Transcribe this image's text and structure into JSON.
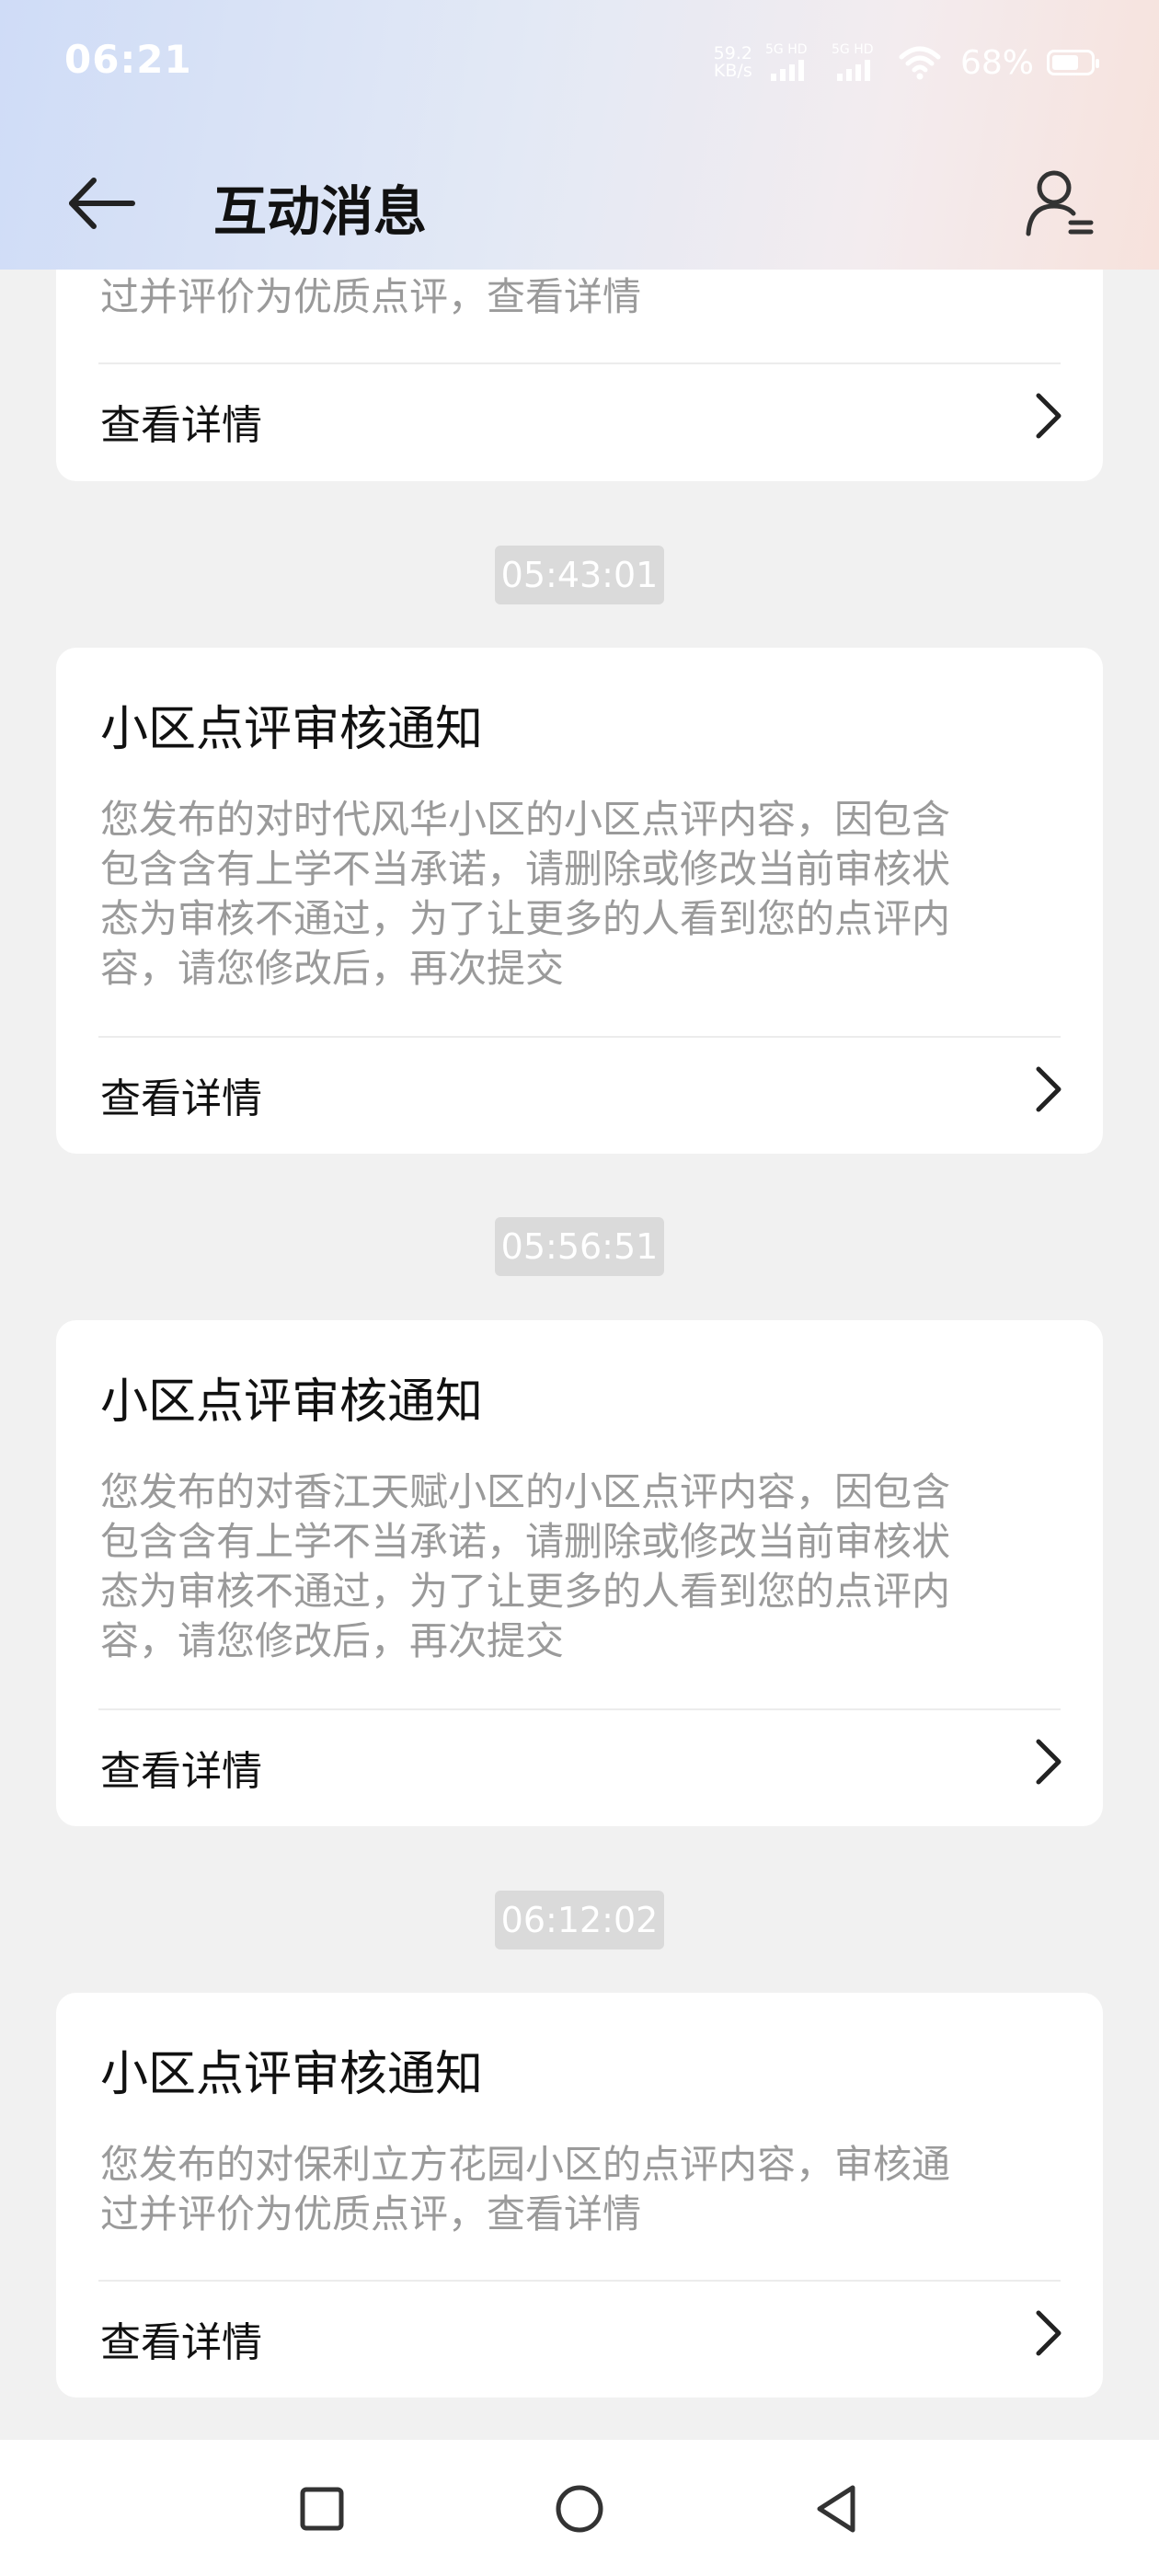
{
  "status_bar": {
    "time": "06:21",
    "net_speed_value": "59.2",
    "net_speed_unit": "KB/s",
    "sim1_tag": "5G HD",
    "sim2_tag": "5G HD",
    "battery": "68%"
  },
  "header": {
    "title": "互动消息",
    "back_icon": "arrow-left-icon",
    "profile_icon": "user-list-icon"
  },
  "cards": [
    {
      "title": "",
      "body_tail": "过并评价为优质点评，查看详情",
      "detail": "查看详情"
    },
    {
      "time": "05:43:01",
      "title": "小区点评审核通知",
      "body": [
        "您发布的对时代风华小区的小区点评内容，因包含",
        "包含含有上学不当承诺，请删除或修改当前审核状",
        "态为审核不通过，为了让更多的人看到您的点评内",
        "容，请您修改后，再次提交"
      ],
      "detail": "查看详情"
    },
    {
      "time": "05:56:51",
      "title": "小区点评审核通知",
      "body": [
        "您发布的对香江天赋小区的小区点评内容，因包含",
        "包含含有上学不当承诺，请删除或修改当前审核状",
        "态为审核不通过，为了让更多的人看到您的点评内",
        "容，请您修改后，再次提交"
      ],
      "detail": "查看详情"
    },
    {
      "time": "06:12:02",
      "title": "小区点评审核通知",
      "body": [
        "您发布的对保利立方花园小区的点评内容，审核通",
        "过并评价为优质点评，查看详情"
      ],
      "detail": "查看详情"
    }
  ],
  "colors": {
    "background": "#f1f1f1",
    "card": "#ffffff",
    "body_text": "#9a9a9a",
    "time_chip": "#dadada"
  },
  "nav_bar": {
    "recent_icon": "square-icon",
    "home_icon": "circle-icon",
    "back_icon": "triangle-back-icon"
  }
}
